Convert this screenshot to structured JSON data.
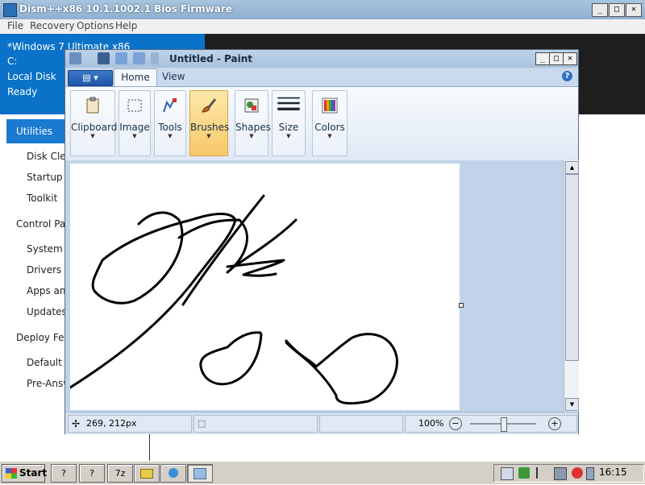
{
  "dism": {
    "title": "Dism++x86 10.1.1002.1 Bios Firmware",
    "menu": [
      "File",
      "Recovery",
      "Options",
      "Help"
    ],
    "info": [
      "*Windows 7 Ultimate x86",
      "C:",
      "Local Disk",
      "Ready"
    ],
    "sidebar": {
      "active": "Utilities",
      "items": [
        "Disk Clea",
        "Startup",
        "Toolkit",
        "Control Par",
        "System C",
        "Drivers",
        "Apps and",
        "Updates",
        "Deploy Feat",
        "Default A",
        "Pre-Answ"
      ]
    }
  },
  "paint": {
    "title": "Untitled - Paint",
    "tabs": {
      "home": "Home",
      "view": "View"
    },
    "help": "?",
    "ribbon": {
      "clipboard": "Clipboard",
      "image": "Image",
      "tools": "Tools",
      "brushes": "Brushes",
      "shapes": "Shapes",
      "size": "Size",
      "colors": "Colors"
    },
    "status": {
      "cursor": "269, 212px",
      "zoom": "100%",
      "zoom_slider_fraction": 0.5
    }
  },
  "taskbar": {
    "start": "Start",
    "tasks": [
      "?",
      "?",
      "7z",
      "",
      "",
      ""
    ],
    "clock": "16:15"
  },
  "colors": {
    "dism_blue": "#0a72c8",
    "paint_frame": "#bdd1e6",
    "brushes_active": "#f7c96b"
  }
}
